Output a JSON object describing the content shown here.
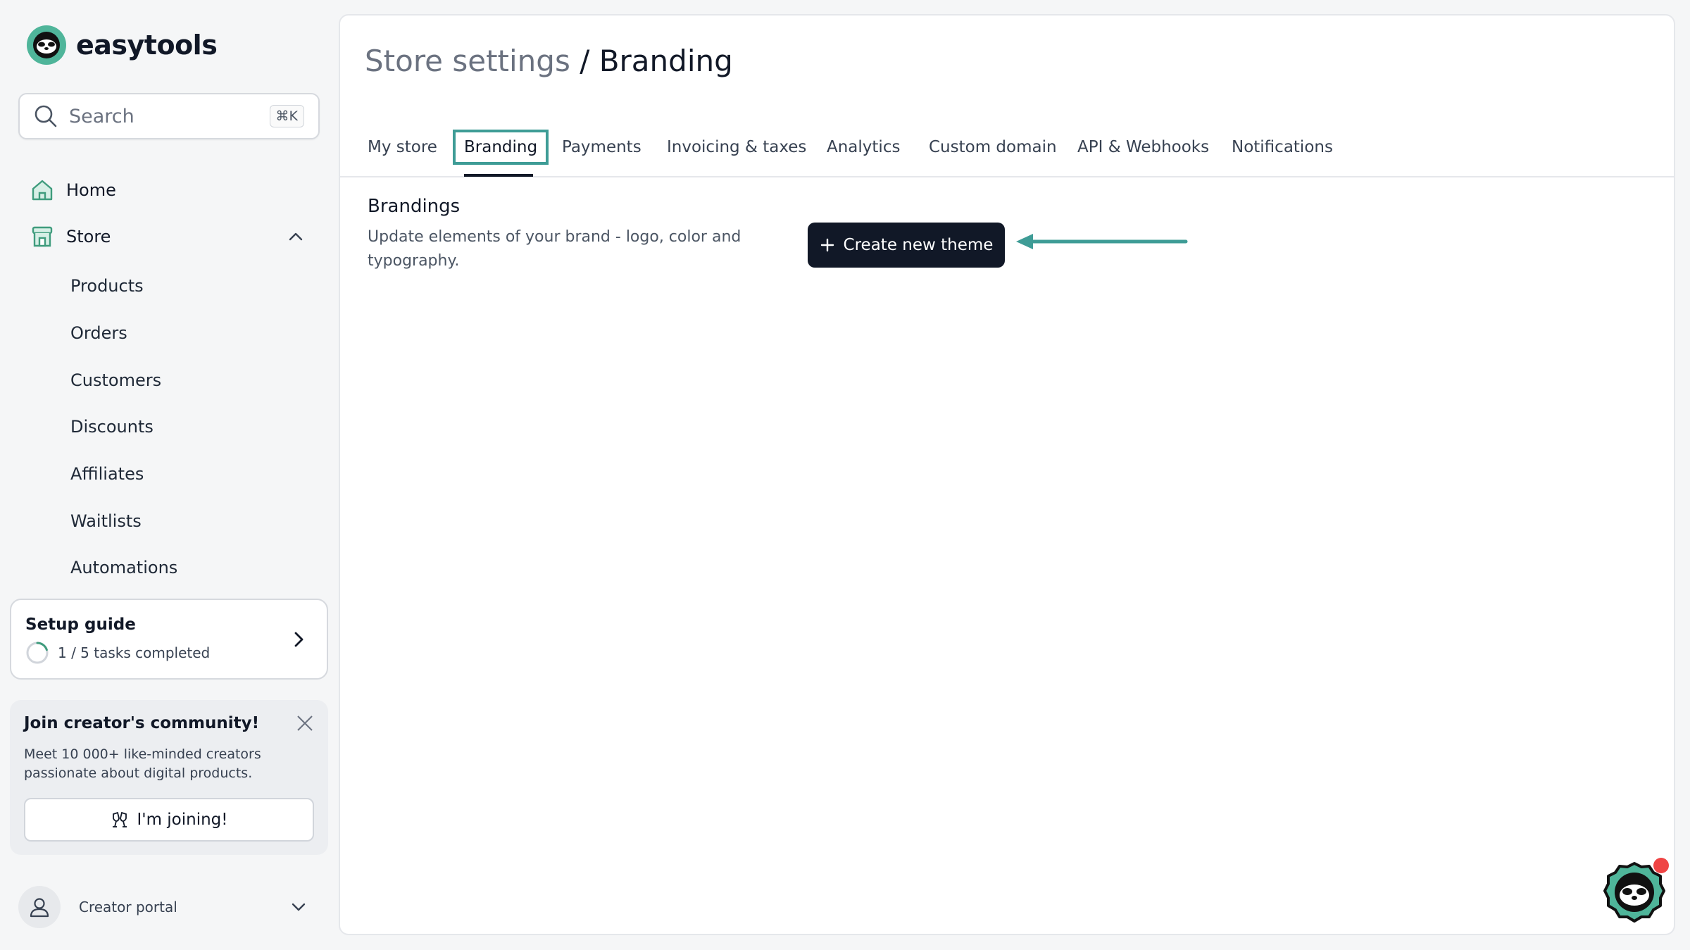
{
  "brand": {
    "name": "easytools"
  },
  "search": {
    "placeholder": "Search",
    "shortcut": "⌘K"
  },
  "nav": {
    "home": "Home",
    "store": "Store",
    "store_items": [
      "Products",
      "Orders",
      "Customers",
      "Discounts",
      "Affiliates",
      "Waitlists",
      "Automations"
    ]
  },
  "setup_guide": {
    "title": "Setup guide",
    "progress": "1 / 5 tasks completed",
    "completed": 1,
    "total": 5
  },
  "community": {
    "title": "Join creator's community!",
    "text": "Meet 10 000+ like-minded creators passionate about digital products.",
    "button": "I'm joining!"
  },
  "account": {
    "label": "Creator portal"
  },
  "page": {
    "breadcrumb_parent": "Store settings",
    "separator": " / ",
    "title": "Branding"
  },
  "tabs": [
    "My store",
    "Branding",
    "Payments",
    "Invoicing & taxes",
    "Analytics",
    "Custom domain",
    "API & Webhooks",
    "Notifications"
  ],
  "active_tab": "Branding",
  "section": {
    "title": "Brandings",
    "description": "Update elements of your brand - logo, color and typography.",
    "create_button": "Create new theme"
  },
  "colors": {
    "brand_green": "#4fb59a",
    "annotation_teal": "#3e9c96",
    "primary_button": "#111827",
    "notification": "#ef4444"
  }
}
